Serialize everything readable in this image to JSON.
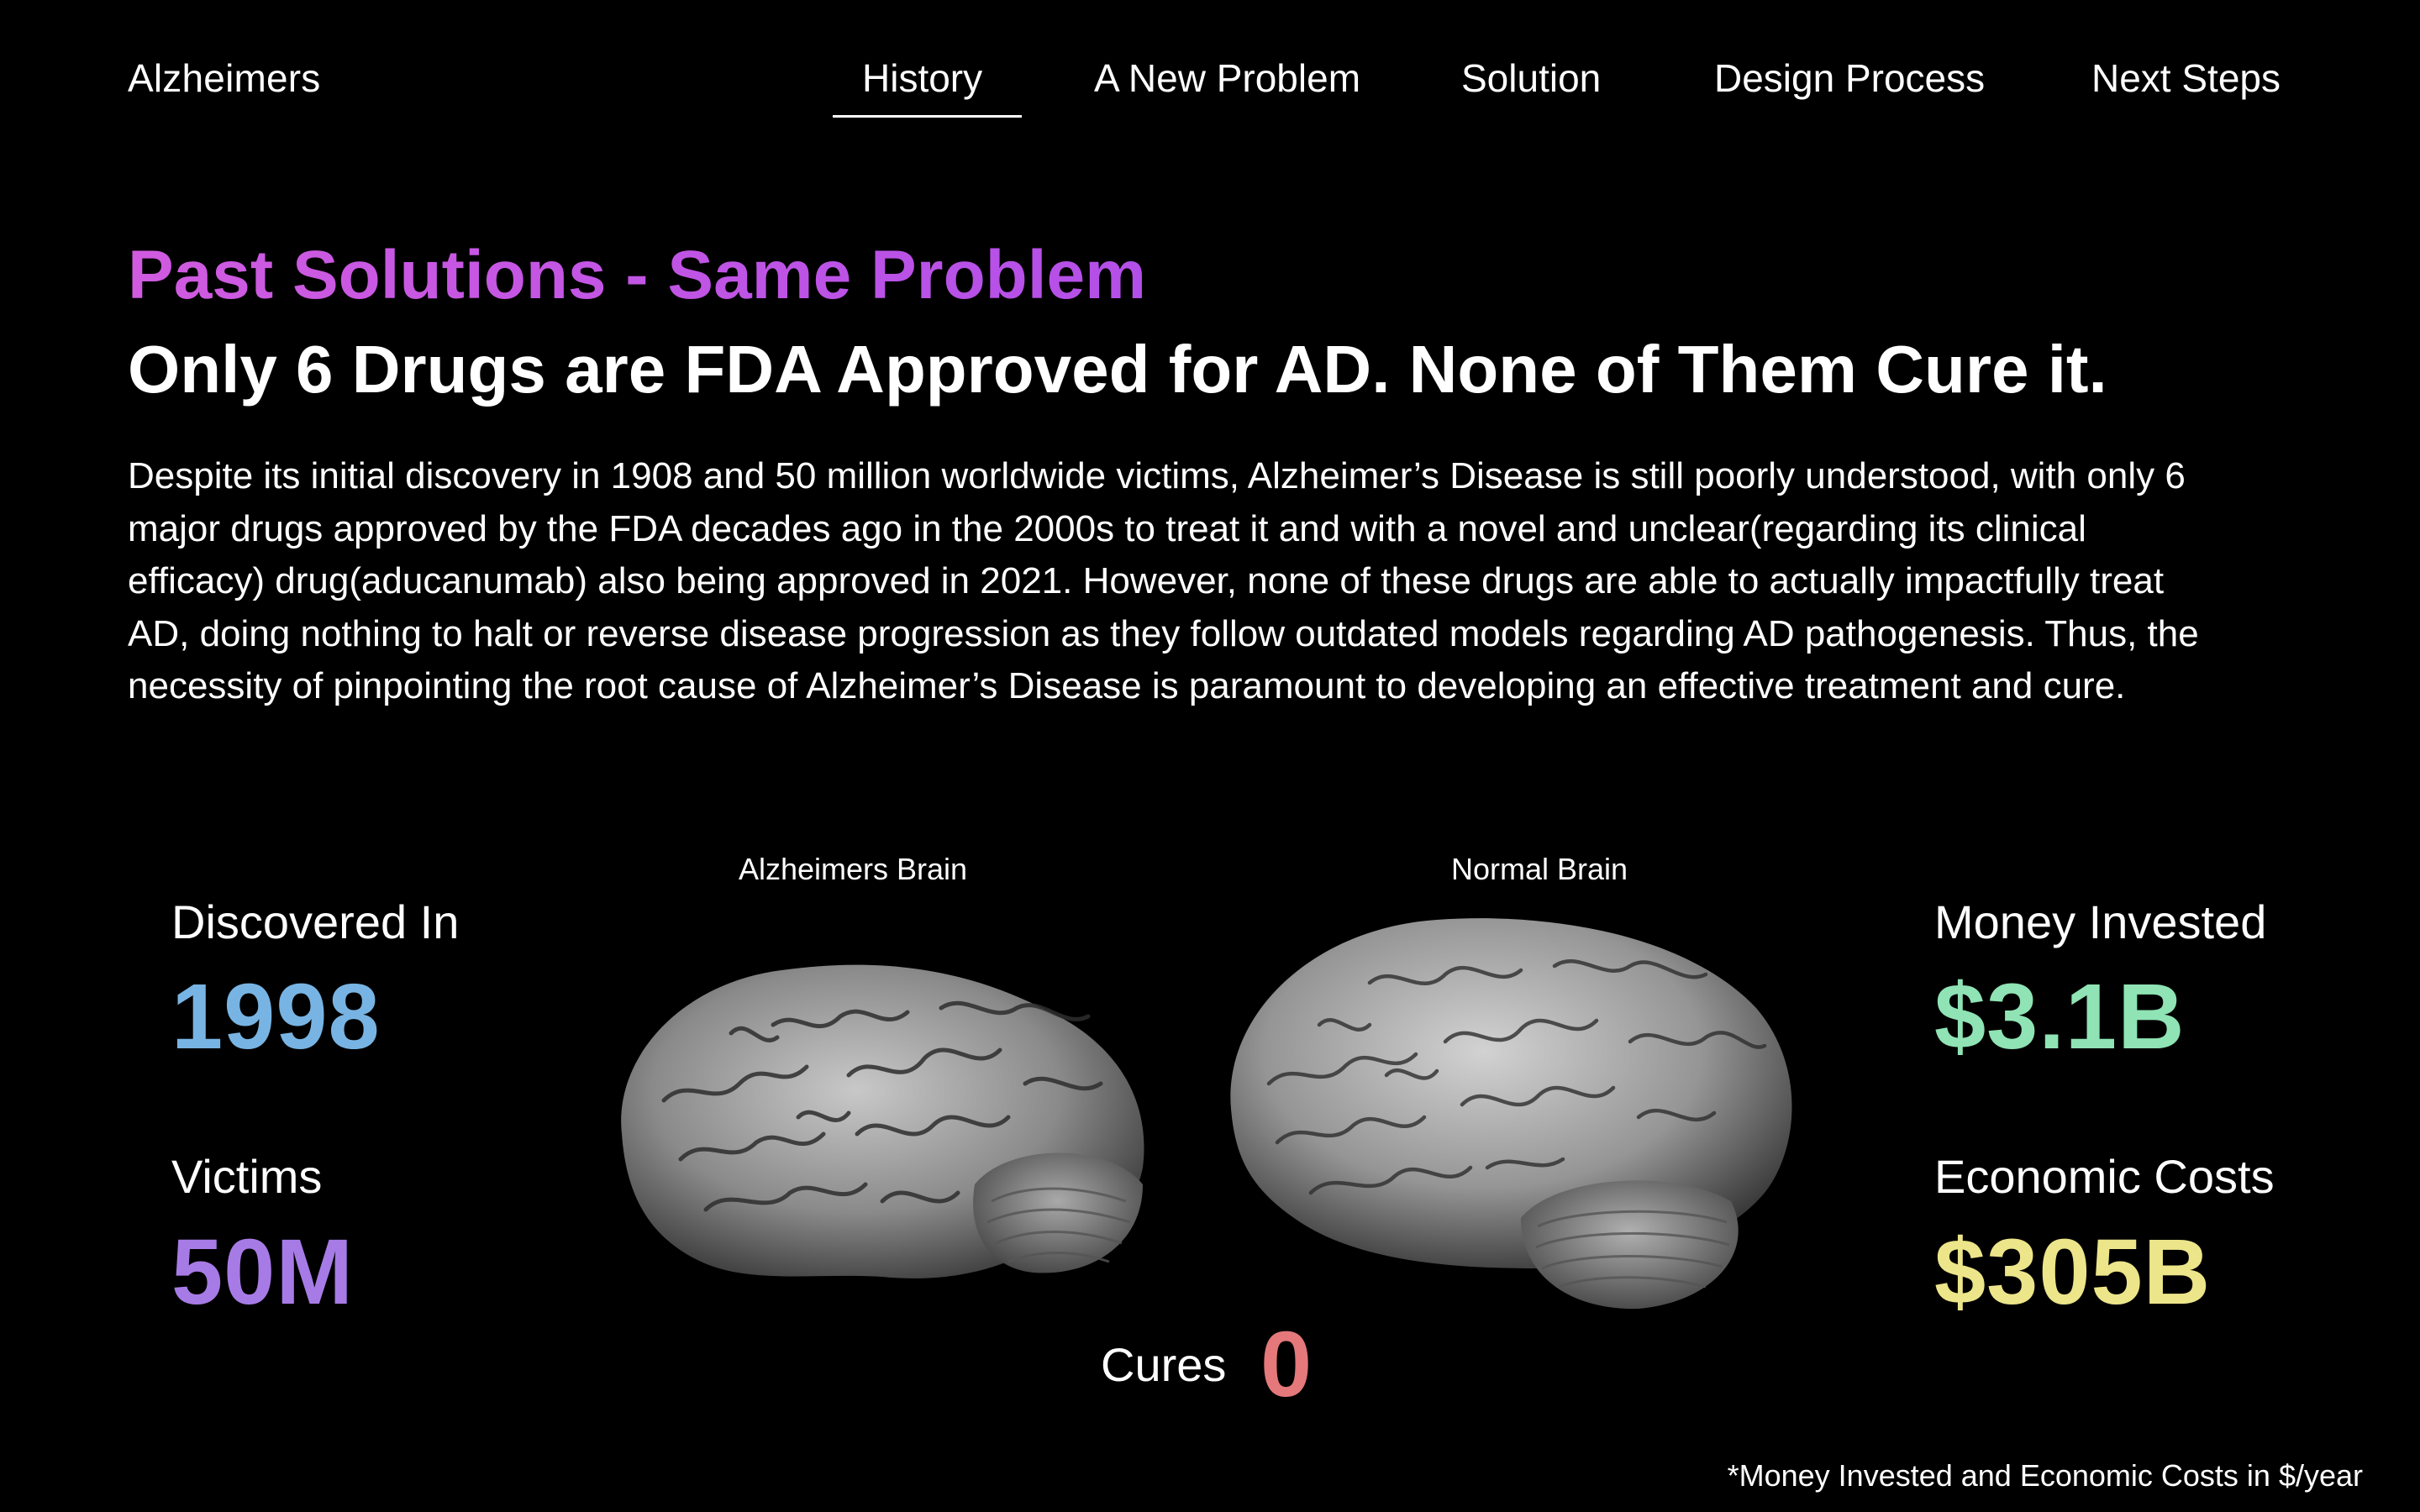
{
  "brand": "Alzheimers",
  "nav": {
    "items": [
      "History",
      "A New Problem",
      "Solution",
      "Design Process",
      "Next Steps"
    ],
    "active": "History"
  },
  "section": {
    "kicker": "Past Solutions - Same Problem",
    "headline": "Only 6 Drugs are FDA Approved for AD. None of Them Cure it.",
    "body": "Despite its initial discovery in 1908 and 50 million worldwide victims, Alzheimer’s Disease is still poorly understood, with only 6 major drugs approved by the FDA decades ago in the 2000s to treat it and with a novel and unclear(regarding its clinical efficacy) drug(aducanumab) also being approved in 2021. However, none of these drugs are able to actually impactfully treat AD, doing nothing to halt or reverse disease progression as they follow outdated models regarding AD pathogenesis. Thus, the necessity of pinpointing the root cause of Alzheimer’s Disease is paramount to developing an effective treatment and cure."
  },
  "stats": {
    "discovered": {
      "label": "Discovered In",
      "value": "1998",
      "color": "#78b4e3"
    },
    "victims": {
      "label": "Victims",
      "value": "50M",
      "color": "#a77be6"
    },
    "money": {
      "label": "Money Invested",
      "value": "$3.1B",
      "color": "#8fe3b4"
    },
    "econ": {
      "label": "Economic Costs",
      "value": "$305B",
      "color": "#ece58a"
    },
    "cures": {
      "label": "Cures",
      "value": "0",
      "color": "#e4787a"
    }
  },
  "images": {
    "ad_caption": "Alzheimers Brain",
    "normal_caption": "Normal Brain"
  },
  "colors": {
    "kicker_gradient_start": "#d05be0",
    "kicker_gradient_end": "#b34fe8"
  },
  "footnote": "*Money Invested and Economic Costs in $/year"
}
